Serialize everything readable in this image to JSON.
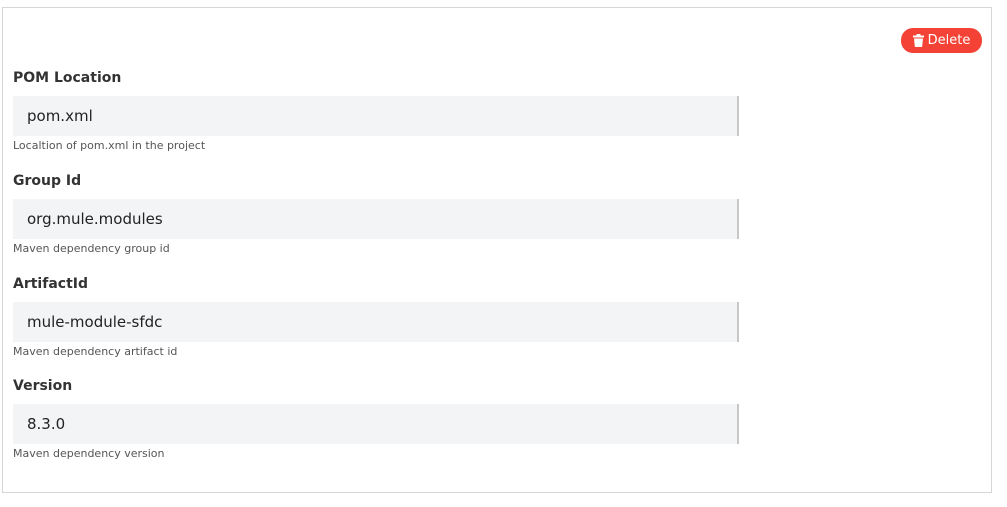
{
  "actions": {
    "delete_label": "Delete"
  },
  "fields": [
    {
      "label": "POM Location",
      "value": "pom.xml",
      "help": "Localtion of pom.xml in the project"
    },
    {
      "label": "Group Id",
      "value": "org.mule.modules",
      "help": "Maven dependency group id"
    },
    {
      "label": "ArtifactId",
      "value": "mule-module-sfdc",
      "help": "Maven dependency artifact id"
    },
    {
      "label": "Version",
      "value": "8.3.0",
      "help": "Maven dependency version"
    }
  ],
  "colors": {
    "danger": "#f44336",
    "input_bg": "#f3f4f6"
  }
}
